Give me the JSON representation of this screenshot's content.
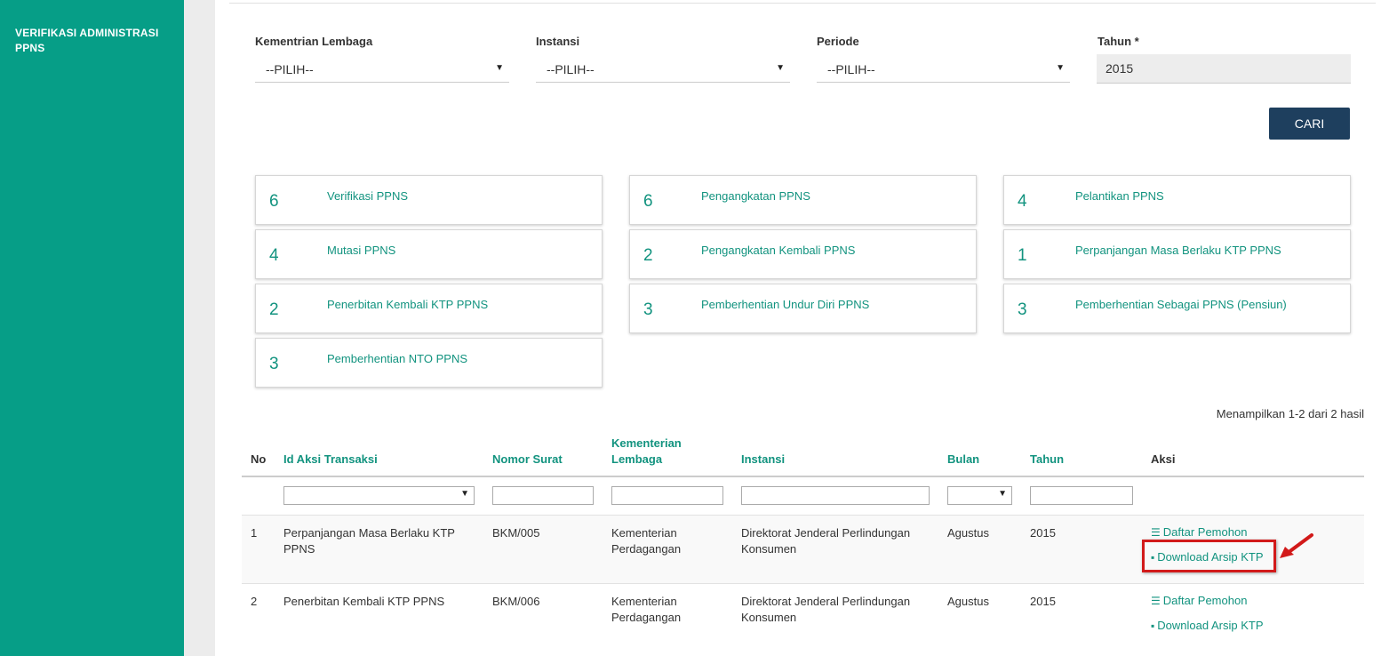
{
  "sidebar": {
    "title": "VERIFIKASI ADMINISTRASI PPNS"
  },
  "filters": {
    "kementrian_label": "Kementrian Lembaga",
    "kementrian_value": "--PILIH--",
    "instansi_label": "Instansi",
    "instansi_value": "--PILIH--",
    "periode_label": "Periode",
    "periode_value": "--PILIH--",
    "tahun_label": "Tahun *",
    "tahun_value": "2015",
    "search_button": "CARI"
  },
  "cards": [
    {
      "count": "6",
      "label": "Verifikasi PPNS"
    },
    {
      "count": "6",
      "label": "Pengangkatan PPNS"
    },
    {
      "count": "4",
      "label": "Pelantikan PPNS"
    },
    {
      "count": "4",
      "label": "Mutasi PPNS"
    },
    {
      "count": "2",
      "label": "Pengangkatan Kembali PPNS"
    },
    {
      "count": "1",
      "label": "Perpanjangan Masa Berlaku KTP PPNS"
    },
    {
      "count": "2",
      "label": "Penerbitan Kembali KTP PPNS"
    },
    {
      "count": "3",
      "label": "Pemberhentian Undur Diri PPNS"
    },
    {
      "count": "3",
      "label": "Pemberhentian Sebagai PPNS (Pensiun)"
    },
    {
      "count": "3",
      "label": "Pemberhentian NTO PPNS"
    }
  ],
  "table": {
    "summary": "Menampilkan 1-2 dari 2 hasil",
    "headers": {
      "no": "No",
      "id": "Id Aksi Transaksi",
      "nomor": "Nomor Surat",
      "kementerian_1": "Kementerian",
      "kementerian_2": "Lembaga",
      "instansi": "Instansi",
      "bulan": "Bulan",
      "tahun": "Tahun",
      "aksi": "Aksi"
    },
    "rows": [
      {
        "no": "1",
        "id_1": "Perpanjangan Masa Berlaku KTP",
        "id_2": "PPNS",
        "nomor": "BKM/005",
        "kementerian_1": "Kementerian",
        "kementerian_2": "Perdagangan",
        "instansi_1": "Direktorat Jenderal Perlindungan",
        "instansi_2": "Konsumen",
        "bulan": "Agustus",
        "tahun": "2015",
        "action_1": "Daftar Pemohon",
        "action_2": "Download Arsip KTP"
      },
      {
        "no": "2",
        "id_1": "Penerbitan Kembali KTP PPNS",
        "id_2": "",
        "nomor": "BKM/006",
        "kementerian_1": "Kementerian",
        "kementerian_2": "Perdagangan",
        "instansi_1": "Direktorat Jenderal Perlindungan",
        "instansi_2": "Konsumen",
        "bulan": "Agustus",
        "tahun": "2015",
        "action_1": "Daftar Pemohon",
        "action_2": "Download Arsip KTP"
      }
    ]
  },
  "icons": {
    "list": "list-icon",
    "file": "file-icon",
    "caret": "caret-down-icon",
    "arrow": "red-arrow-icon"
  },
  "colors": {
    "sidebar": "#069e87",
    "accent": "#12937f",
    "button": "#1e3f5e",
    "highlight": "#d21a1a"
  }
}
